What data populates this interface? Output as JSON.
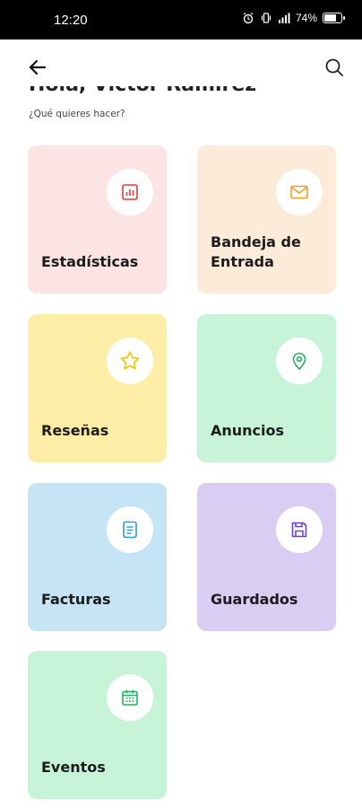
{
  "status_bar": {
    "time": "12:20",
    "battery": "74%",
    "battery_level": 0.74
  },
  "header": {
    "greeting": "Hola, Victor Ramirez",
    "subtitle": "¿Qué quieres hacer?"
  },
  "cards": [
    {
      "label": "Estadísticas",
      "icon": "bar-chart-icon",
      "bg": "#fce4e4",
      "color": "#e53935"
    },
    {
      "label": "Bandeja de Entrada",
      "icon": "mail-icon",
      "bg": "#fdebd9",
      "color": "#f59e24"
    },
    {
      "label": "Reseñas",
      "icon": "star-icon",
      "bg": "#fdeda6",
      "color": "#f1c40f"
    },
    {
      "label": "Anuncios",
      "icon": "location-pin-icon",
      "bg": "#c7f3d8",
      "color": "#27ae60"
    },
    {
      "label": "Facturas",
      "icon": "invoice-icon",
      "bg": "#c5e4f6",
      "color": "#2d9cdb"
    },
    {
      "label": "Guardados",
      "icon": "save-icon",
      "bg": "#d9cdf3",
      "color": "#6b3fd4"
    },
    {
      "label": "Eventos",
      "icon": "calendar-icon",
      "bg": "#c7f3d8",
      "color": "#27ae60"
    }
  ]
}
